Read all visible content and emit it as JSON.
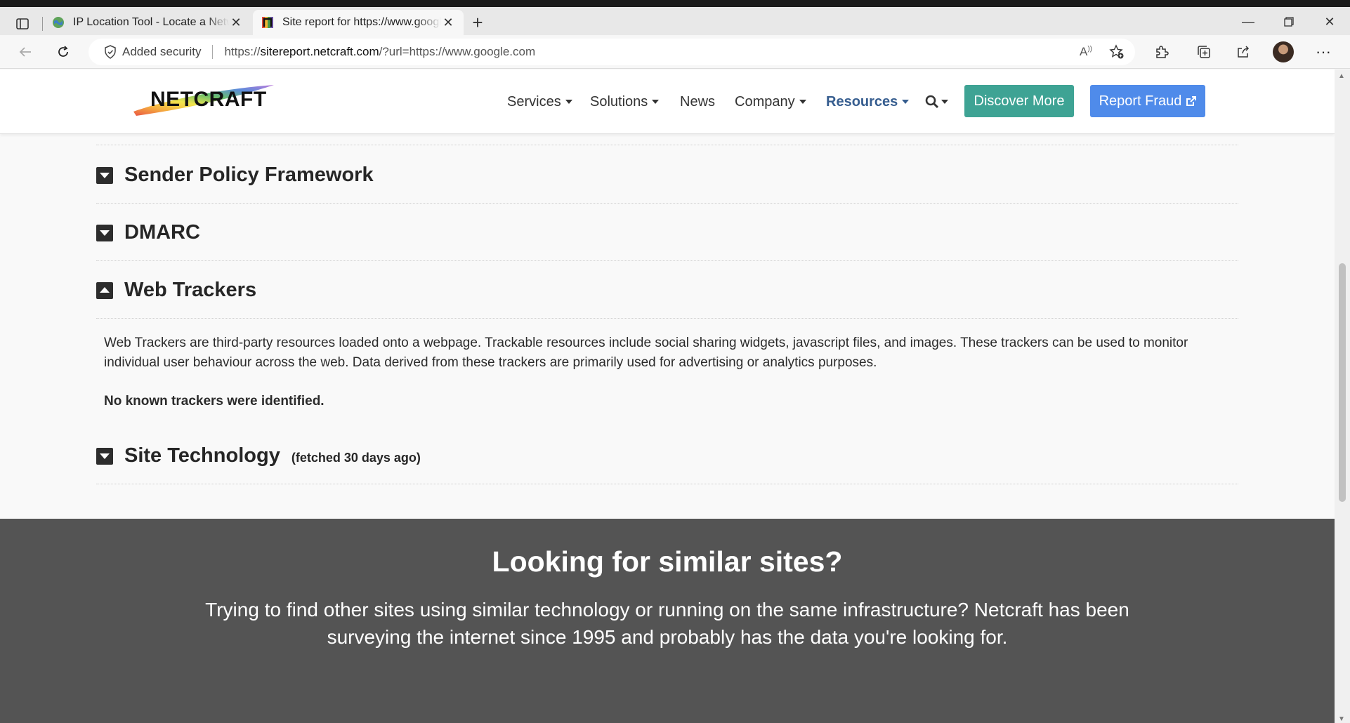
{
  "browser": {
    "tabs": [
      {
        "title": "IP Location Tool - Locate a Network",
        "active": false
      },
      {
        "title": "Site report for https://www.google.com",
        "active": true
      }
    ],
    "address": {
      "security_label": "Added security",
      "url_prefix": "https://",
      "url_host": "sitereport.netcraft.com",
      "url_rest": "/?url=https://www.google.com"
    }
  },
  "site": {
    "logo_text": "NETCRAFT",
    "nav": {
      "services": "Services",
      "solutions": "Solutions",
      "news": "News",
      "company": "Company",
      "resources": "Resources",
      "discover": "Discover More",
      "report_fraud": "Report Fraud"
    },
    "sections": {
      "spf": "Sender Policy Framework",
      "dmarc": "DMARC",
      "trackers": "Web Trackers",
      "tech": "Site Technology",
      "tech_fetched": "(fetched 30 days ago)"
    },
    "trackers_description": "Web Trackers are third-party resources loaded onto a webpage. Trackable resources include social sharing widgets, javascript files, and images. These trackers can be used to monitor individual user behaviour across the web. Data derived from these trackers are primarily used for advertising or analytics purposes.",
    "trackers_result": "No known trackers were identified.",
    "footer": {
      "title": "Looking for similar sites?",
      "text": "Trying to find other sites using similar technology or running on the same infrastructure? Netcraft has been surveying the internet since 1995 and probably has the data you're looking for."
    }
  },
  "colors": {
    "accent_blue": "#4f8bea",
    "accent_green": "#3ea394",
    "active_nav": "#365d8f",
    "footer_bg": "#545454",
    "footer_button": "#ef5b4a"
  }
}
